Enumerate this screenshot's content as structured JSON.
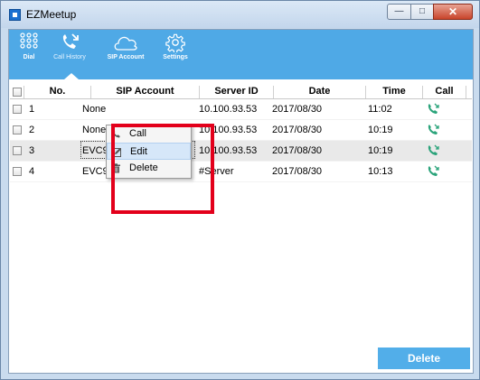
{
  "window": {
    "title": "EZMeetup",
    "buttons": {
      "minimize": "—",
      "maximize": "□",
      "close": "✕"
    }
  },
  "toolbar": {
    "items": [
      {
        "label": "Dial",
        "icon": "dial-pad-icon"
      },
      {
        "label": "Call History",
        "icon": "call-history-icon"
      },
      {
        "label": "SIP Account",
        "icon": "cloud-icon"
      },
      {
        "label": "Settings",
        "icon": "gear-icon"
      }
    ],
    "active": "Call History",
    "colors": {
      "background": "#4fa9e6",
      "accent": "#2aa37a"
    }
  },
  "table": {
    "columns": [
      "No.",
      "SIP Account",
      "Server ID",
      "Date",
      "Time",
      "Call"
    ],
    "rows": [
      {
        "no": "1",
        "sip": "None",
        "server": "10.100.93.53",
        "date": "2017/08/30",
        "time": "11:02"
      },
      {
        "no": "2",
        "sip": "None",
        "server": "10.100.93.53",
        "date": "2017/08/30",
        "time": "10:19"
      },
      {
        "no": "3",
        "sip": "EVC900",
        "server": "10.100.93.53",
        "date": "2017/08/30",
        "time": "10:19"
      },
      {
        "no": "4",
        "sip": "EVC900",
        "server": "#Server",
        "date": "2017/08/30",
        "time": "10:13"
      }
    ],
    "selected_row": "3"
  },
  "context_menu": {
    "items": [
      {
        "label": "Call",
        "icon": "phone-icon"
      },
      {
        "label": "Edit",
        "icon": "edit-icon"
      },
      {
        "label": "Delete",
        "icon": "trash-icon"
      }
    ],
    "hovered": "Edit"
  },
  "footer": {
    "delete_label": "Delete"
  },
  "annotation": {
    "color": "#e3001b"
  }
}
